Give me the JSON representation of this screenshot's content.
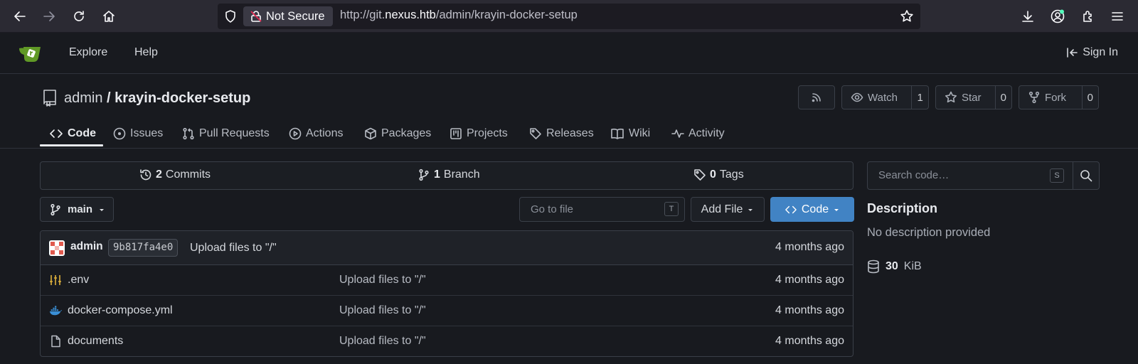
{
  "browser": {
    "not_secure_label": "Not Secure",
    "url_prefix": "http://git.",
    "url_domain": "nexus.htb",
    "url_path": "/admin/krayin-docker-setup"
  },
  "header": {
    "nav": [
      "Explore",
      "Help"
    ],
    "sign_in": "Sign In"
  },
  "repo": {
    "owner": "admin",
    "separator": " / ",
    "name": "krayin-docker-setup",
    "watch_label": "Watch",
    "watch_count": "1",
    "star_label": "Star",
    "star_count": "0",
    "fork_label": "Fork",
    "fork_count": "0"
  },
  "tabs": [
    {
      "label": "Code",
      "icon": "code-icon"
    },
    {
      "label": "Issues",
      "icon": "issue-icon"
    },
    {
      "label": "Pull Requests",
      "icon": "pull-request-icon"
    },
    {
      "label": "Actions",
      "icon": "play-icon"
    },
    {
      "label": "Packages",
      "icon": "package-icon"
    },
    {
      "label": "Projects",
      "icon": "project-icon"
    },
    {
      "label": "Releases",
      "icon": "tag-icon"
    },
    {
      "label": "Wiki",
      "icon": "book-icon"
    },
    {
      "label": "Activity",
      "icon": "pulse-icon"
    }
  ],
  "stats": {
    "commits_count": "2",
    "commits_label": "Commits",
    "branch_count": "1",
    "branch_label": "Branch",
    "tags_count": "0",
    "tags_label": "Tags"
  },
  "toolbar": {
    "branch": "main",
    "goto_placeholder": "Go to file",
    "goto_key": "T",
    "add_file": "Add File",
    "code_button": "Code"
  },
  "latest_commit": {
    "author": "admin",
    "sha": "9b817fa4e0",
    "message": "Upload files to \"/\"",
    "age": "4 months ago"
  },
  "files": [
    {
      "name": ".env",
      "message": "Upload files to \"/\"",
      "age": "4 months ago",
      "icon": "settings-file-icon"
    },
    {
      "name": "docker-compose.yml",
      "message": "Upload files to \"/\"",
      "age": "4 months ago",
      "icon": "docker-icon"
    },
    {
      "name": "documents",
      "message": "Upload files to \"/\"",
      "age": "4 months ago",
      "icon": "file-icon"
    }
  ],
  "sidebar": {
    "search_placeholder": "Search code…",
    "search_key": "S",
    "description_heading": "Description",
    "description_value": "No description provided",
    "size_value": "30",
    "size_unit": "KiB"
  },
  "colors": {
    "accent": "#4183c4",
    "background": "#181a1f",
    "chrome": "#2b2a33",
    "env_icon": "#e0b23c",
    "docker_icon": "#3a8fd6"
  }
}
